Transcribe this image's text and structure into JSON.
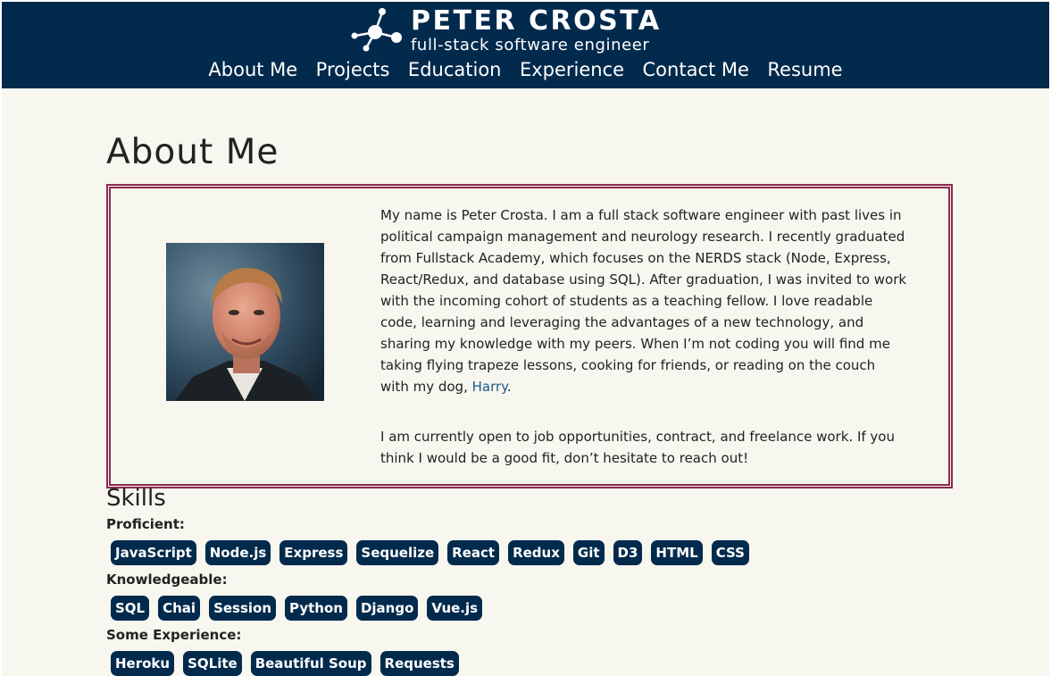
{
  "header": {
    "name": "PETER CROSTA",
    "tagline": "full-stack software engineer",
    "logo_icon": "molecule-network-icon"
  },
  "nav": {
    "items": [
      {
        "label": "About Me"
      },
      {
        "label": "Projects"
      },
      {
        "label": "Education"
      },
      {
        "label": "Experience"
      },
      {
        "label": "Contact Me"
      },
      {
        "label": "Resume"
      }
    ]
  },
  "about": {
    "title": "About Me",
    "bio_paragraph_1": "My name is Peter Crosta. I am a full stack software engineer with past lives in political campaign management and neurology research. I recently graduated from Fullstack Academy, which focuses on the NERDS stack (Node, Express, React/Redux, and database using SQL). After graduation, I was invited to work with the incoming cohort of students as a teaching fellow. I love readable code, learning and leveraging the advantages of a new technology, and sharing my knowledge with my peers. When I’m not coding you will find me taking flying trapeze lessons, cooking for friends, or reading on the couch with my dog, ",
    "dog_link": "Harry",
    "bio_paragraph_1_end": ".",
    "bio_paragraph_2": "I am currently open to job opportunities, contract, and freelance work. If you think I would be a good fit, don’t hesitate to reach out!"
  },
  "skills": {
    "title": "Skills",
    "proficient_label": "Proficient:",
    "proficient": [
      "JavaScript",
      "Node.js",
      "Express",
      "Sequelize",
      "React",
      "Redux",
      "Git",
      "D3",
      "HTML",
      "CSS"
    ],
    "knowledgeable_label": "Knowledgeable:",
    "knowledgeable": [
      "SQL",
      "Chai",
      "Session",
      "Python",
      "Django",
      "Vue.js"
    ],
    "some_experience_label": "Some Experience:",
    "some_experience": [
      "Heroku",
      "SQLite",
      "Beautiful Soup",
      "Requests"
    ]
  },
  "colors": {
    "header_bg": "#022a4c",
    "page_bg": "#f7f6ef",
    "accent_border": "#8b2c4f",
    "link": "#1e5a8c",
    "pill_bg": "#022a4c"
  }
}
